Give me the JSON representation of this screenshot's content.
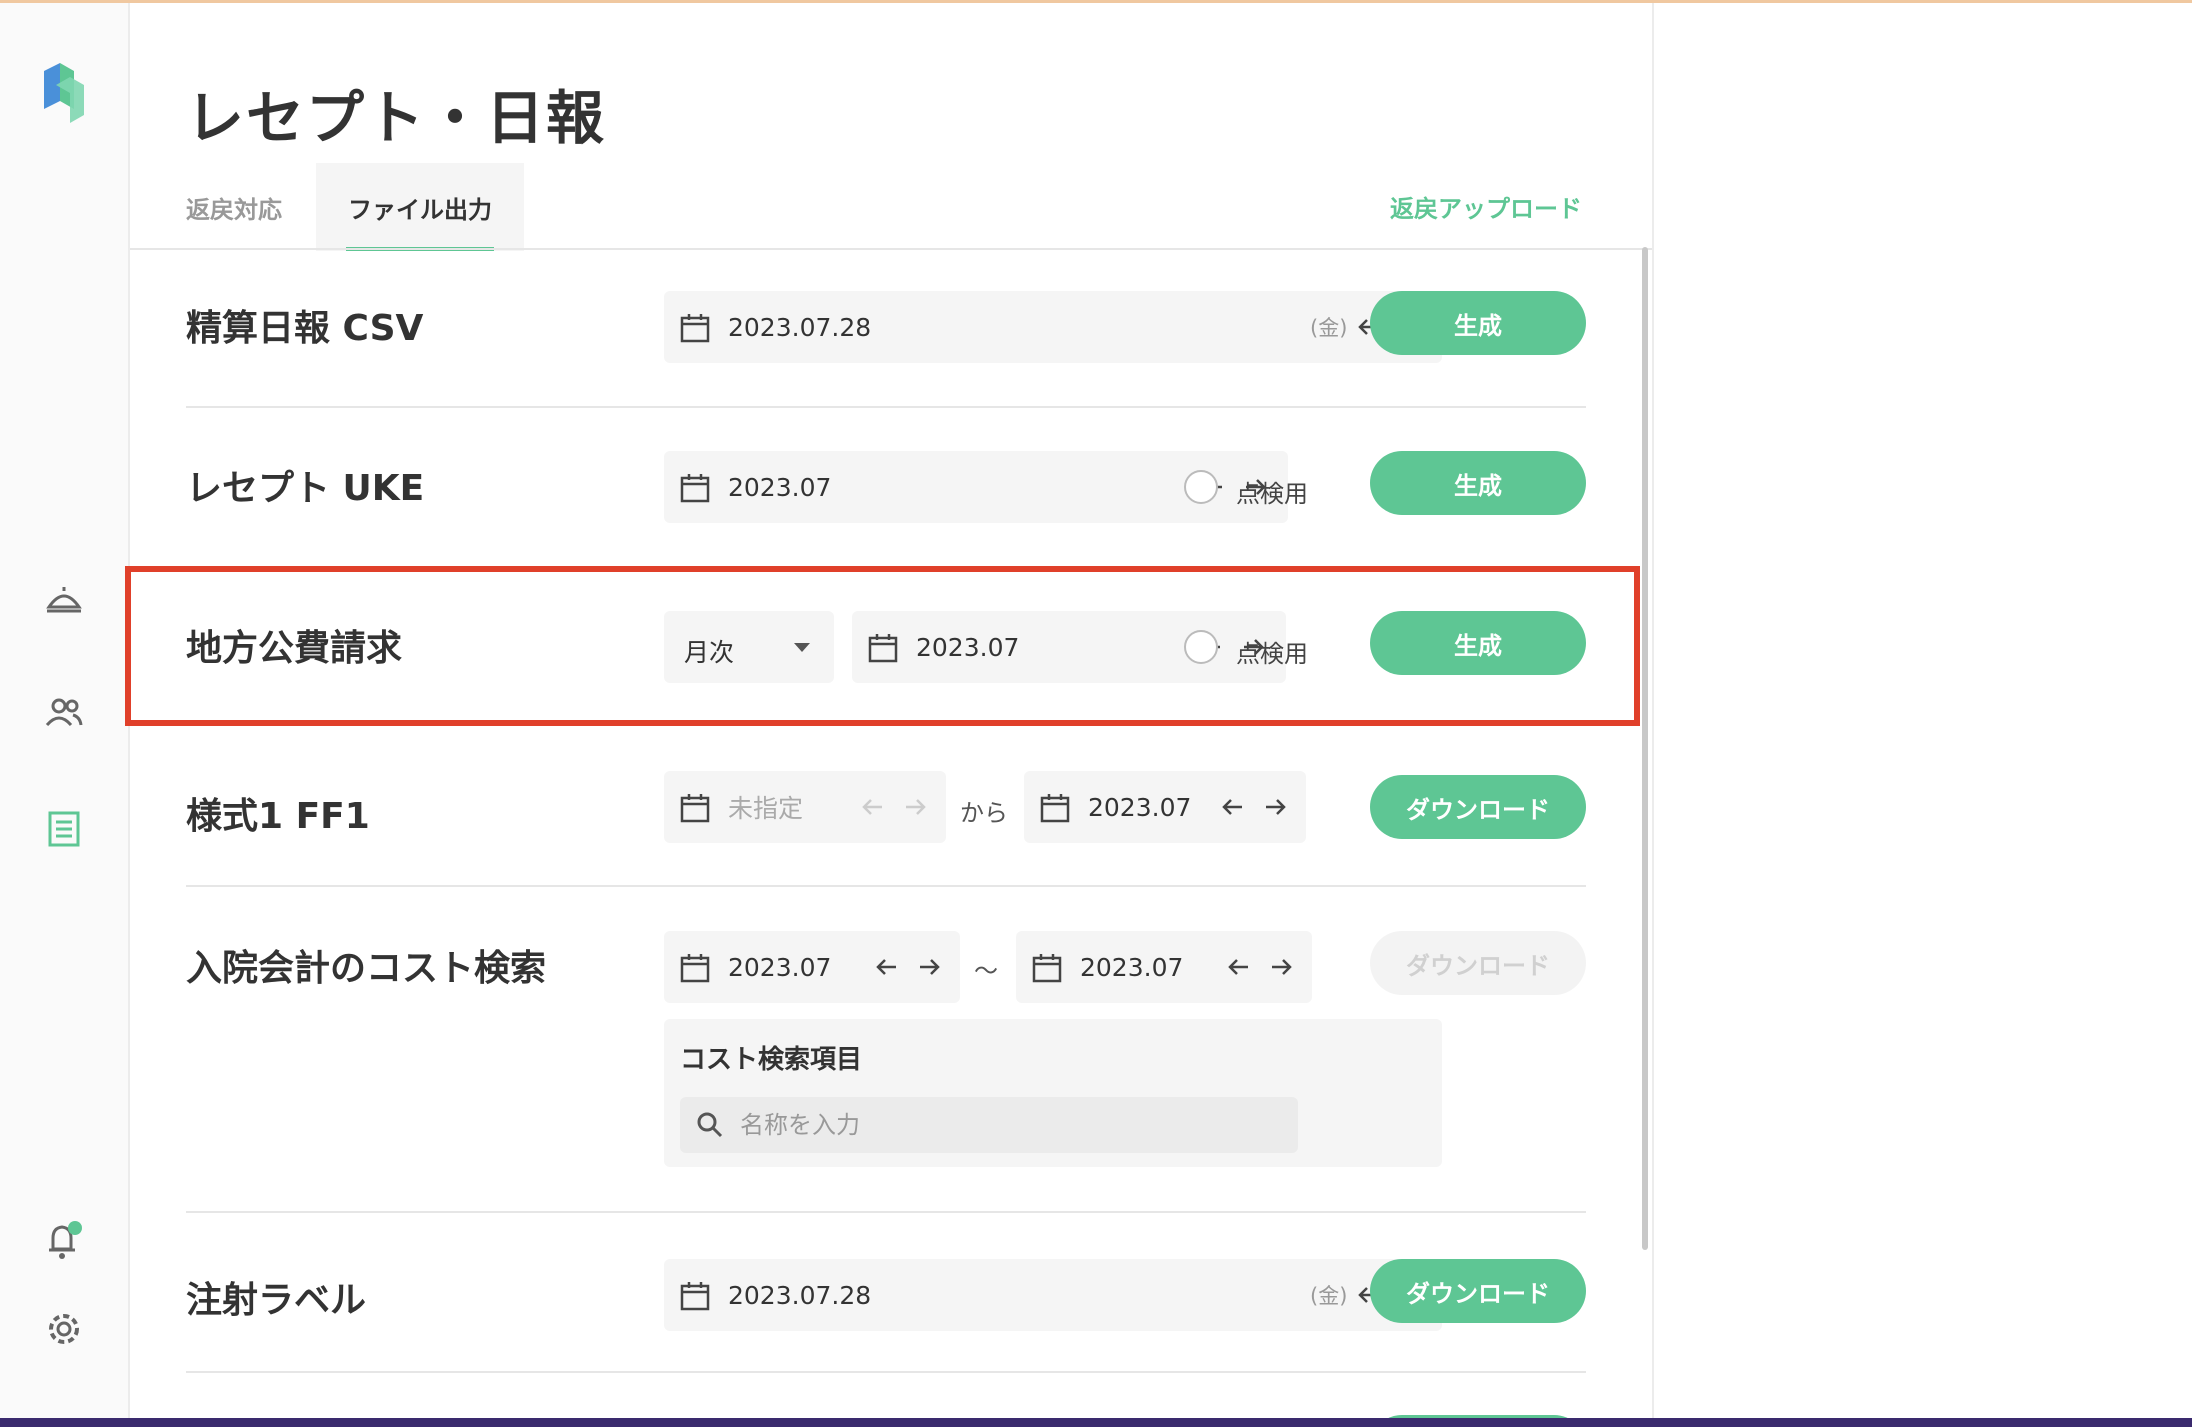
{
  "page": {
    "title": "レセプト・日報"
  },
  "tabs": [
    {
      "label": "返戻対応",
      "active": false
    },
    {
      "label": "ファイル出力",
      "active": true
    }
  ],
  "upload_link": "返戻アップロード",
  "sidebar": {
    "icons": [
      "logo-icon",
      "reception-bell-icon",
      "patients-icon",
      "receipt-icon",
      "notification-icon",
      "settings-icon"
    ],
    "notification_dot_color": "#5ec694"
  },
  "rows": {
    "daily_csv": {
      "title": "精算日報 CSV",
      "date": "2023.07.28",
      "weekday": "(金)",
      "button": "生成"
    },
    "receipt_uke": {
      "title": "レセプト UKE",
      "date": "2023.07",
      "checkbox_label": "点検用",
      "button": "生成"
    },
    "local_public": {
      "title": "地方公費請求",
      "period_select": "月次",
      "date": "2023.07",
      "checkbox_label": "点検用",
      "button": "生成"
    },
    "ff1": {
      "title": "様式1 FF1",
      "from_placeholder": "未指定",
      "from_word": "から",
      "to_date": "2023.07",
      "button": "ダウンロード"
    },
    "cost_search": {
      "title": "入院会計のコスト検索",
      "from_date": "2023.07",
      "range_sep": "〜",
      "to_date": "2023.07",
      "button": "ダウンロード",
      "items_label": "コスト検索項目",
      "search_placeholder": "名称を入力"
    },
    "injection_label": {
      "title": "注射ラベル",
      "date": "2023.07.28",
      "weekday": "(金)",
      "button": "ダウンロード"
    }
  },
  "colors": {
    "accent": "#5ec694",
    "highlight": "#e0402a",
    "disabled_button_bg": "#f3f3f3"
  }
}
